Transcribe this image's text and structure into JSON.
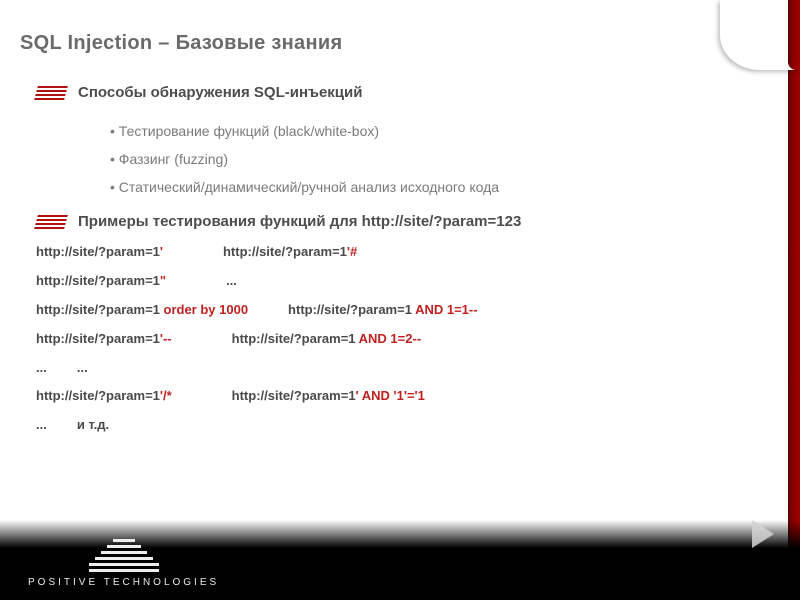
{
  "title": "SQL Injection – Базовые знания",
  "section1": {
    "heading": "Способы обнаружения SQL-инъекций",
    "items": [
      "Тестирование функций (black/white-box)",
      "Фаззинг (fuzzing)",
      "Статический/динамический/ручной анализ исходного кода"
    ]
  },
  "section2": {
    "heading": "Примеры тестирования функций для http://site/?param=123"
  },
  "examples": {
    "base": "http://site/?param=1",
    "r1c1_suffix": "'",
    "r1c2_suffix": "'#",
    "r2c1_suffix": "\"",
    "r2c2": "...",
    "r3c1_suffix": " order by 1000",
    "r3c2_suffix": " AND 1=1--",
    "r4c1_suffix": "'--",
    "r4c2_suffix": " AND 1=2--",
    "r5c1": "...",
    "r5c2": "...",
    "r6c1_suffix": "'/*",
    "r6c2_suffix": "' AND '1'='1",
    "r7c1": "...",
    "r7c2": "и т.д."
  },
  "logo": {
    "text": "POSITIVE  TECHNOLOGIES"
  }
}
